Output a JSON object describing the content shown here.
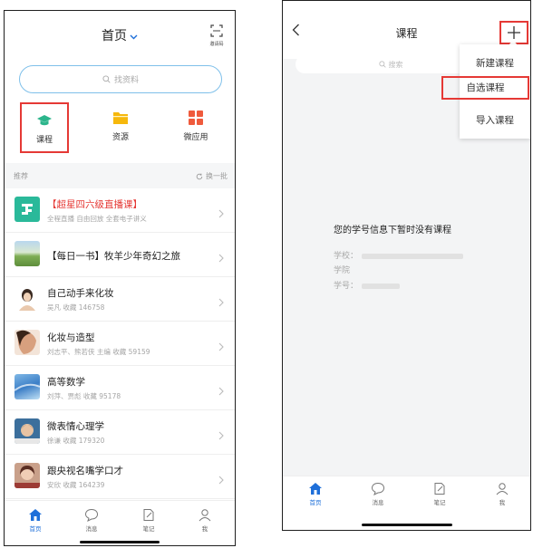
{
  "left_screen": {
    "header": {
      "title": "首页",
      "scan_label": "邀请码"
    },
    "search": {
      "placeholder": "找资料"
    },
    "quick_actions": [
      {
        "label": "课程",
        "icon": "graduation-cap-icon",
        "color": "#2bb58b"
      },
      {
        "label": "资源",
        "icon": "folder-icon",
        "color": "#f6b80c"
      },
      {
        "label": "微应用",
        "icon": "grid-icon",
        "color": "#ef5a3c"
      }
    ],
    "section": {
      "title": "推荐",
      "refresh_label": "换一批"
    },
    "recommendations": [
      {
        "title": "【超星四六级直播课】",
        "subtitle": "全程直播 自由回放 全套电子讲义"
      },
      {
        "title": "【每日一书】牧羊少年奇幻之旅",
        "subtitle": ""
      },
      {
        "title": "自己动手来化妆",
        "subtitle": "吴凡 收藏 146758"
      },
      {
        "title": "化妆与造型",
        "subtitle": "刘志平、熊若侠 主编 收藏 59159"
      },
      {
        "title": "高等数学",
        "subtitle": "刘萍、贾彪 收藏 95178"
      },
      {
        "title": "微表情心理学",
        "subtitle": "徐谦 收藏 179320"
      },
      {
        "title": "跟央视名嘴学口才",
        "subtitle": "安欣 收藏 164239"
      }
    ],
    "tabbar": [
      {
        "label": "首页",
        "icon": "home-icon"
      },
      {
        "label": "消息",
        "icon": "message-icon"
      },
      {
        "label": "笔记",
        "icon": "note-icon"
      },
      {
        "label": "我",
        "icon": "person-icon"
      }
    ]
  },
  "right_screen": {
    "header": {
      "title": "课程"
    },
    "search": {
      "placeholder": "搜索"
    },
    "menu": {
      "items": [
        "新建课程",
        "自选课程",
        "导入课程"
      ]
    },
    "empty_message": "您的学号信息下暂时没有课程",
    "info": {
      "school_label": "学校：",
      "college_label": "学院",
      "student_no_label": "学号："
    },
    "tabbar": [
      {
        "label": "首页",
        "icon": "home-icon"
      },
      {
        "label": "消息",
        "icon": "message-icon"
      },
      {
        "label": "笔记",
        "icon": "note-icon"
      },
      {
        "label": "我",
        "icon": "person-icon"
      }
    ]
  },
  "colors": {
    "accent": "#1e6fd9",
    "highlight": "#e53935",
    "live_red": "#e53935"
  }
}
